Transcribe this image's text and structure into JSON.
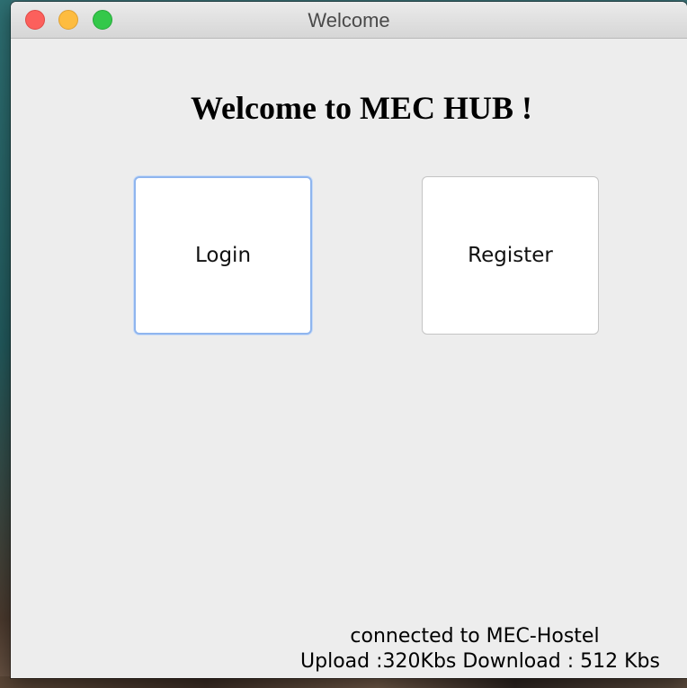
{
  "window": {
    "title": "Welcome",
    "traffic_lights": [
      "close",
      "minimize",
      "zoom"
    ]
  },
  "main": {
    "heading": "Welcome to MEC HUB !",
    "login_label": "Login",
    "register_label": "Register"
  },
  "status": {
    "connection": "connected to MEC-Hostel",
    "speeds": "Upload :320Kbs Download : 512 Kbs"
  },
  "colors": {
    "close": "#fc605c",
    "minimize": "#fdbc40",
    "zoom": "#34c84a",
    "focus_ring": "#8fb5ee",
    "window_bg": "#ececec"
  }
}
